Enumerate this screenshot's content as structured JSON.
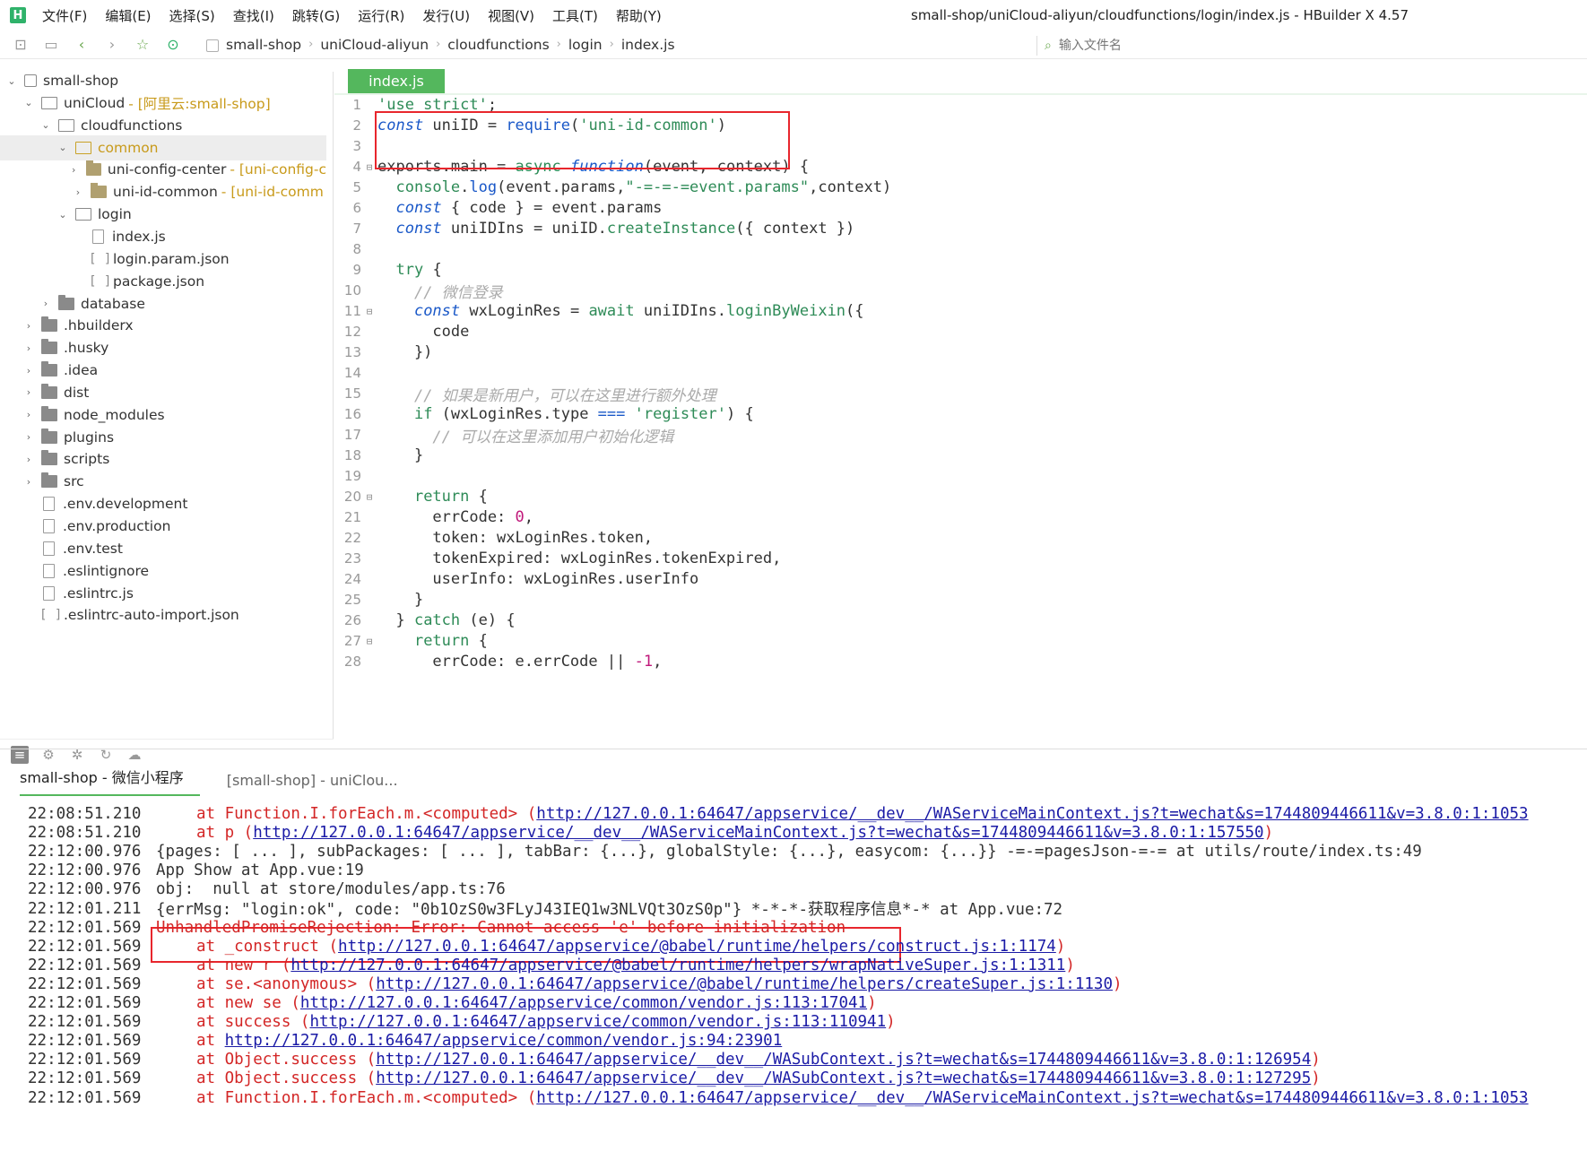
{
  "app": {
    "logo_letter": "H",
    "window_title": "small-shop/uniCloud-aliyun/cloudfunctions/login/index.js - HBuilder X 4.57"
  },
  "menu": [
    "文件(F)",
    "编辑(E)",
    "选择(S)",
    "查找(I)",
    "跳转(G)",
    "运行(R)",
    "发行(U)",
    "视图(V)",
    "工具(T)",
    "帮助(Y)"
  ],
  "toolbar": {
    "breadcrumb": [
      "small-shop",
      "uniCloud-aliyun",
      "cloudfunctions",
      "login",
      "index.js"
    ],
    "file_search_placeholder": "输入文件名"
  },
  "sidebar": {
    "tree": [
      {
        "label": "small-shop",
        "arrow": "v",
        "icon": "project"
      },
      {
        "label": "uniCloud",
        "note": "- [阿里云:small-shop]",
        "arrow": "v",
        "icon": "open"
      },
      {
        "label": "cloudfunctions",
        "arrow": "v",
        "icon": "open"
      },
      {
        "label": "common",
        "arrow": "v",
        "icon": "open-gold",
        "selected": true
      },
      {
        "label": "uni-config-center",
        "note": "- [uni-config-c",
        "arrow": ">",
        "icon": "module"
      },
      {
        "label": "uni-id-common",
        "note": "- [uni-id-comm",
        "arrow": ">",
        "icon": "module"
      },
      {
        "label": "login",
        "arrow": "v",
        "icon": "open"
      },
      {
        "label": "index.js",
        "icon": "file"
      },
      {
        "label": "login.param.json",
        "icon": "json"
      },
      {
        "label": "package.json",
        "icon": "json"
      },
      {
        "label": "database",
        "arrow": ">",
        "icon": "closed"
      },
      {
        "label": ".hbuilderx",
        "arrow": ">",
        "icon": "closed"
      },
      {
        "label": ".husky",
        "arrow": ">",
        "icon": "closed"
      },
      {
        "label": ".idea",
        "arrow": ">",
        "icon": "closed"
      },
      {
        "label": "dist",
        "arrow": ">",
        "icon": "closed"
      },
      {
        "label": "node_modules",
        "arrow": ">",
        "icon": "closed"
      },
      {
        "label": "plugins",
        "arrow": ">",
        "icon": "closed"
      },
      {
        "label": "scripts",
        "arrow": ">",
        "icon": "closed"
      },
      {
        "label": "src",
        "arrow": ">",
        "icon": "closed"
      },
      {
        "label": ".env.development",
        "icon": "file"
      },
      {
        "label": ".env.production",
        "icon": "file"
      },
      {
        "label": ".env.test",
        "icon": "file"
      },
      {
        "label": ".eslintignore",
        "icon": "file"
      },
      {
        "label": ".eslintrc.js",
        "icon": "file"
      },
      {
        "label": ".eslintrc-auto-import.json",
        "icon": "json"
      }
    ]
  },
  "editor": {
    "tab_label": "index.js",
    "lines": [
      {
        "n": "1",
        "segs": [
          [
            "str",
            "'use strict'"
          ],
          [
            "pn",
            ";"
          ]
        ]
      },
      {
        "n": "2",
        "segs": [
          [
            "kw",
            "const"
          ],
          [
            "pn",
            " uniID = "
          ],
          [
            "fn",
            "require"
          ],
          [
            "pn",
            "("
          ],
          [
            "str",
            "'uni-id-common'"
          ],
          [
            "pn",
            ")"
          ]
        ]
      },
      {
        "n": "3",
        "segs": []
      },
      {
        "n": "4",
        "fold": true,
        "segs": [
          [
            "pn",
            "exports.main = "
          ],
          [
            "ctrl",
            "async"
          ],
          [
            "pn",
            " "
          ],
          [
            "kw",
            "function"
          ],
          [
            "pn",
            "(event, context) {"
          ]
        ]
      },
      {
        "n": "5",
        "segs": [
          [
            "pn",
            "  "
          ],
          [
            "ctrl",
            "console"
          ],
          [
            "pn",
            "."
          ],
          [
            "fn",
            "log"
          ],
          [
            "pn",
            "(event.params,"
          ],
          [
            "str",
            "\"-=-=-=event.params\""
          ],
          [
            "pn",
            ",context)"
          ]
        ]
      },
      {
        "n": "6",
        "segs": [
          [
            "pn",
            "  "
          ],
          [
            "kw",
            "const"
          ],
          [
            "pn",
            " { code } = event.params"
          ]
        ]
      },
      {
        "n": "7",
        "segs": [
          [
            "pn",
            "  "
          ],
          [
            "kw",
            "const"
          ],
          [
            "pn",
            " uniIDIns = uniID."
          ],
          [
            "ctrl",
            "createInstance"
          ],
          [
            "pn",
            "({ context })"
          ]
        ]
      },
      {
        "n": "8",
        "segs": []
      },
      {
        "n": "9",
        "segs": [
          [
            "pn",
            "  "
          ],
          [
            "ctrl",
            "try"
          ],
          [
            "pn",
            " {"
          ]
        ]
      },
      {
        "n": "10",
        "segs": [
          [
            "pn",
            "    "
          ],
          [
            "cm",
            "// 微信登录"
          ]
        ]
      },
      {
        "n": "11",
        "fold": true,
        "segs": [
          [
            "pn",
            "    "
          ],
          [
            "kw",
            "const"
          ],
          [
            "pn",
            " wxLoginRes = "
          ],
          [
            "ctrl",
            "await"
          ],
          [
            "pn",
            " uniIDIns."
          ],
          [
            "ctrl",
            "loginByWeixin"
          ],
          [
            "pn",
            "({"
          ]
        ]
      },
      {
        "n": "12",
        "segs": [
          [
            "pn",
            "      code"
          ]
        ]
      },
      {
        "n": "13",
        "segs": [
          [
            "pn",
            "    })"
          ]
        ]
      },
      {
        "n": "14",
        "segs": []
      },
      {
        "n": "15",
        "segs": [
          [
            "pn",
            "    "
          ],
          [
            "cm",
            "// 如果是新用户，可以在这里进行额外处理"
          ]
        ]
      },
      {
        "n": "16",
        "segs": [
          [
            "pn",
            "    "
          ],
          [
            "ctrl",
            "if"
          ],
          [
            "pn",
            " (wxLoginRes.type "
          ],
          [
            "kw2",
            "==="
          ],
          [
            "pn",
            " "
          ],
          [
            "str",
            "'register'"
          ],
          [
            "pn",
            ") {"
          ]
        ]
      },
      {
        "n": "17",
        "segs": [
          [
            "pn",
            "      "
          ],
          [
            "cm",
            "// 可以在这里添加用户初始化逻辑"
          ]
        ]
      },
      {
        "n": "18",
        "segs": [
          [
            "pn",
            "    }"
          ]
        ]
      },
      {
        "n": "19",
        "segs": []
      },
      {
        "n": "20",
        "fold": true,
        "segs": [
          [
            "pn",
            "    "
          ],
          [
            "ctrl",
            "return"
          ],
          [
            "pn",
            " {"
          ]
        ]
      },
      {
        "n": "21",
        "segs": [
          [
            "pn",
            "      errCode: "
          ],
          [
            "num",
            "0"
          ],
          [
            "pn",
            ","
          ]
        ]
      },
      {
        "n": "22",
        "segs": [
          [
            "pn",
            "      token: wxLoginRes.token,"
          ]
        ]
      },
      {
        "n": "23",
        "segs": [
          [
            "pn",
            "      tokenExpired: wxLoginRes.tokenExpired,"
          ]
        ]
      },
      {
        "n": "24",
        "segs": [
          [
            "pn",
            "      userInfo: wxLoginRes.userInfo"
          ]
        ]
      },
      {
        "n": "25",
        "segs": [
          [
            "pn",
            "    }"
          ]
        ]
      },
      {
        "n": "26",
        "segs": [
          [
            "pn",
            "  } "
          ],
          [
            "ctrl",
            "catch"
          ],
          [
            "pn",
            " (e) {"
          ]
        ]
      },
      {
        "n": "27",
        "fold": true,
        "segs": [
          [
            "pn",
            "    "
          ],
          [
            "ctrl",
            "return"
          ],
          [
            "pn",
            " {"
          ]
        ]
      },
      {
        "n": "28",
        "segs": [
          [
            "pn",
            "      errCode: e.errCode || "
          ],
          [
            "num",
            "-1"
          ],
          [
            "pn",
            ","
          ]
        ]
      }
    ]
  },
  "console": {
    "tabs": [
      "small-shop - 微信小程序",
      "[small-shop] - uniClou..."
    ],
    "lines": [
      {
        "t": "22:08:51.210",
        "kind": "at",
        "pre": "at Function.I.forEach.m.<computed> (",
        "link": "http://127.0.0.1:64647/appservice/__dev__/WAServiceMainContext.js?t=wechat&s=1744809446611&v=3.8.0:1:1053",
        "post": ""
      },
      {
        "t": "22:08:51.210",
        "kind": "at",
        "pre": "at p (",
        "link": "http://127.0.0.1:64647/appservice/__dev__/WAServiceMainContext.js?t=wechat&s=1744809446611&v=3.8.0:1:157550",
        "post": ")"
      },
      {
        "t": "22:12:00.976",
        "kind": "pages",
        "text": "{pages: [ ... ], subPackages: [ ... ], tabBar: {...}, globalStyle: {...}, easycom: {...}} -=-=pagesJson-=-= at utils/route/index.ts:49"
      },
      {
        "t": "22:12:00.976",
        "kind": "plain",
        "text": "App Show at App.vue:19"
      },
      {
        "t": "22:12:00.976",
        "kind": "plain",
        "text": "obj:  null at store/modules/app.ts:76"
      },
      {
        "t": "22:12:01.211",
        "kind": "plain",
        "text": "{errMsg: \"login:ok\", code: \"0b1OzS0w3FLyJ43IEQ1w3NLVQt3OzS0p\"} *-*-*-获取程序信息*-* at App.vue:72"
      },
      {
        "t": "22:12:01.569",
        "kind": "err",
        "text": "UnhandledPromiseRejection: Error: Cannot access 'e' before initialization"
      },
      {
        "t": "22:12:01.569",
        "kind": "at",
        "pre": "at _construct (",
        "link": "http://127.0.0.1:64647/appservice/@babel/runtime/helpers/construct.js:1:1174",
        "post": ")"
      },
      {
        "t": "22:12:01.569",
        "kind": "at",
        "pre": "at new r (",
        "link": "http://127.0.0.1:64647/appservice/@babel/runtime/helpers/wrapNativeSuper.js:1:1311",
        "post": ")"
      },
      {
        "t": "22:12:01.569",
        "kind": "at",
        "pre": "at se.<anonymous> (",
        "link": "http://127.0.0.1:64647/appservice/@babel/runtime/helpers/createSuper.js:1:1130",
        "post": ")"
      },
      {
        "t": "22:12:01.569",
        "kind": "at",
        "pre": "at new se (",
        "link": "http://127.0.0.1:64647/appservice/common/vendor.js:113:17041",
        "post": ")"
      },
      {
        "t": "22:12:01.569",
        "kind": "at",
        "pre": "at success (",
        "link": "http://127.0.0.1:64647/appservice/common/vendor.js:113:110941",
        "post": ")"
      },
      {
        "t": "22:12:01.569",
        "kind": "at",
        "pre": "at ",
        "link": "http://127.0.0.1:64647/appservice/common/vendor.js:94:23901",
        "post": ""
      },
      {
        "t": "22:12:01.569",
        "kind": "at",
        "pre": "at Object.success (",
        "link": "http://127.0.0.1:64647/appservice/__dev__/WASubContext.js?t=wechat&s=1744809446611&v=3.8.0:1:126954",
        "post": ")"
      },
      {
        "t": "22:12:01.569",
        "kind": "at",
        "pre": "at Object.success (",
        "link": "http://127.0.0.1:64647/appservice/__dev__/WASubContext.js?t=wechat&s=1744809446611&v=3.8.0:1:127295",
        "post": ")"
      },
      {
        "t": "22:12:01.569",
        "kind": "at",
        "pre": "at Function.I.forEach.m.<computed> (",
        "link": "http://127.0.0.1:64647/appservice/__dev__/WAServiceMainContext.js?t=wechat&s=1744809446611&v=3.8.0:1:1053",
        "post": ""
      }
    ]
  }
}
